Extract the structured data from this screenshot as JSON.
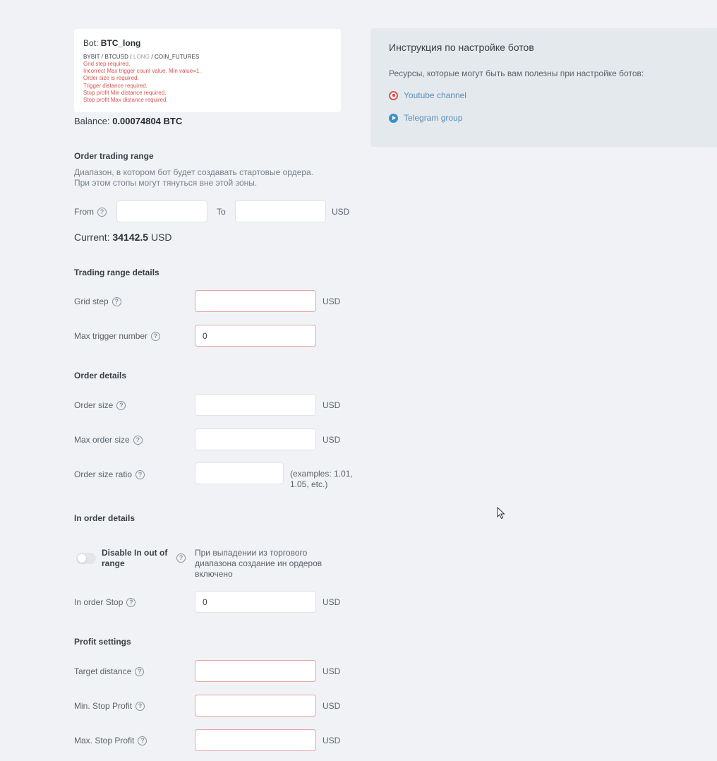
{
  "bot": {
    "title_prefix": "Bot:",
    "name": "BTC_long",
    "exchange": "BYBIT",
    "pair": "BTCUSD",
    "side": "LONG",
    "market": "COIN_FUTURES",
    "errors": [
      "Grid step required.",
      "Incorrect Max trigger count value. Min value=1.",
      "Order size is required.",
      "Trigger distance required.",
      "Stop profit Min distance required.",
      "Stop profit Max distance required."
    ]
  },
  "balance": {
    "label": "Balance:",
    "value": "0.00074804 BTC"
  },
  "order_range": {
    "title": "Order trading range",
    "desc_line1": "Диапазон, в котором бот будет создавать стартовые ордера.",
    "desc_line2": "При этом стопы могут тянуться вне этой зоны.",
    "from_label": "From",
    "to_label": "To",
    "unit": "USD",
    "from_value": "",
    "to_value": "",
    "current_label": "Current:",
    "current_value": "34142.5",
    "current_unit": "USD"
  },
  "range_details": {
    "title": "Trading range details",
    "grid_step_label": "Grid step",
    "grid_step_value": "",
    "grid_step_unit": "USD",
    "max_trigger_label": "Max trigger number",
    "max_trigger_value": "0"
  },
  "order_details": {
    "title": "Order details",
    "order_size_label": "Order size",
    "order_size_value": "",
    "order_size_unit": "USD",
    "max_order_size_label": "Max order size",
    "max_order_size_value": "",
    "max_order_size_unit": "USD",
    "ratio_label": "Order size ratio",
    "ratio_value": "",
    "ratio_hint": "(examples: 1.01, 1.05, etc.)"
  },
  "in_order": {
    "title": "In order details",
    "toggle_label": "Disable In out of range",
    "toggle_on": false,
    "toggle_desc": "При выпадении из торгового диапазона создание ин ордеров включено",
    "stop_label": "In order Stop",
    "stop_value": "0",
    "stop_unit": "USD"
  },
  "profit": {
    "title": "Profit settings",
    "target_label": "Target distance",
    "target_value": "",
    "target_unit": "USD",
    "min_stop_label": "Min. Stop Profit",
    "min_stop_value": "",
    "min_stop_unit": "USD",
    "max_stop_label": "Max. Stop Profit",
    "max_stop_value": "",
    "max_stop_unit": "USD"
  },
  "help_glyph": "?",
  "instructions": {
    "title": "Инструкция по настройке ботов",
    "text": "Ресурсы, которые могут быть вам полезны при настройке ботов:",
    "youtube": "Youtube channel",
    "telegram": "Telegram group"
  },
  "colors": {
    "error": "#d9534f",
    "link": "#5a8fb8",
    "panel_bg": "#e4e9ed",
    "page_bg": "#f0f2f5"
  }
}
